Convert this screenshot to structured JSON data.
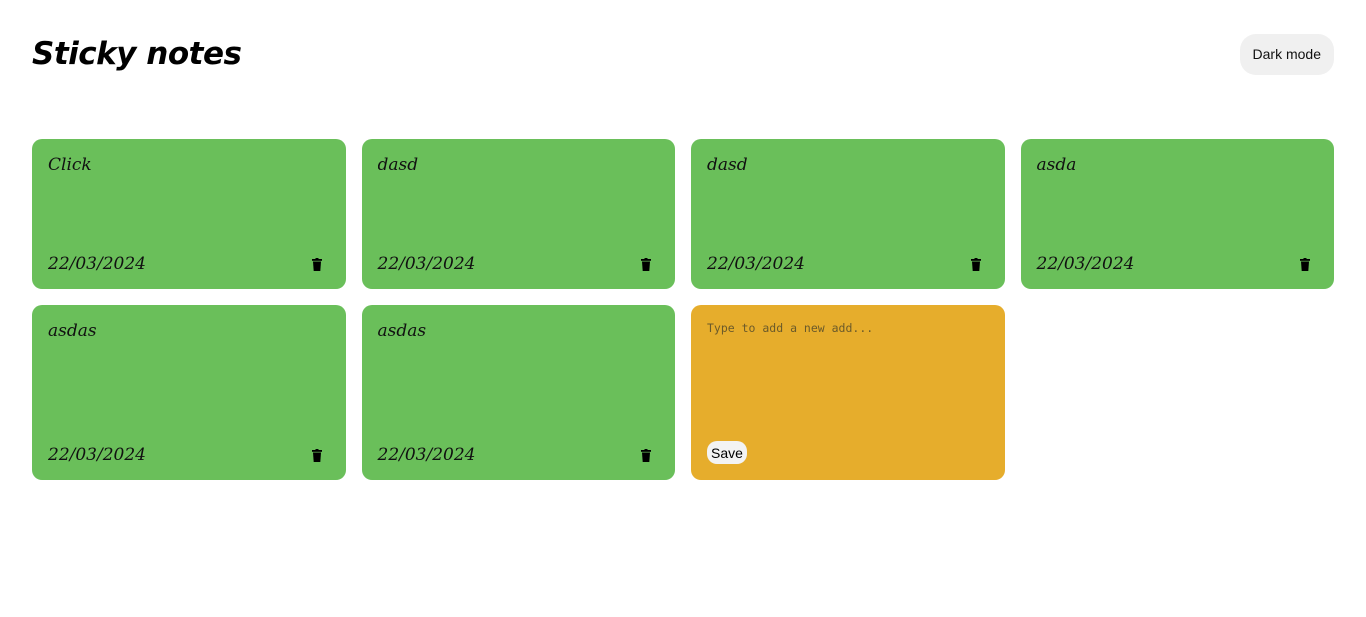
{
  "header": {
    "title": "Sticky notes",
    "dark_mode_label": "Dark mode"
  },
  "colors": {
    "note_green": "#6abf5a",
    "new_note_yellow": "#e6ad2c",
    "toggle_bg": "#f0f0f0"
  },
  "notes": [
    {
      "text": "Click",
      "date": "22/03/2024",
      "delete_icon": "trash-icon"
    },
    {
      "text": "dasd",
      "date": "22/03/2024",
      "delete_icon": "trash-icon"
    },
    {
      "text": "dasd",
      "date": "22/03/2024",
      "delete_icon": "trash-icon"
    },
    {
      "text": "asda",
      "date": "22/03/2024",
      "delete_icon": "trash-icon"
    },
    {
      "text": "asdas",
      "date": "22/03/2024",
      "delete_icon": "trash-icon"
    },
    {
      "text": "asdas",
      "date": "22/03/2024",
      "delete_icon": "trash-icon"
    }
  ],
  "new_note": {
    "value": "",
    "placeholder": "Type to add a new add...",
    "save_label": "Save"
  }
}
